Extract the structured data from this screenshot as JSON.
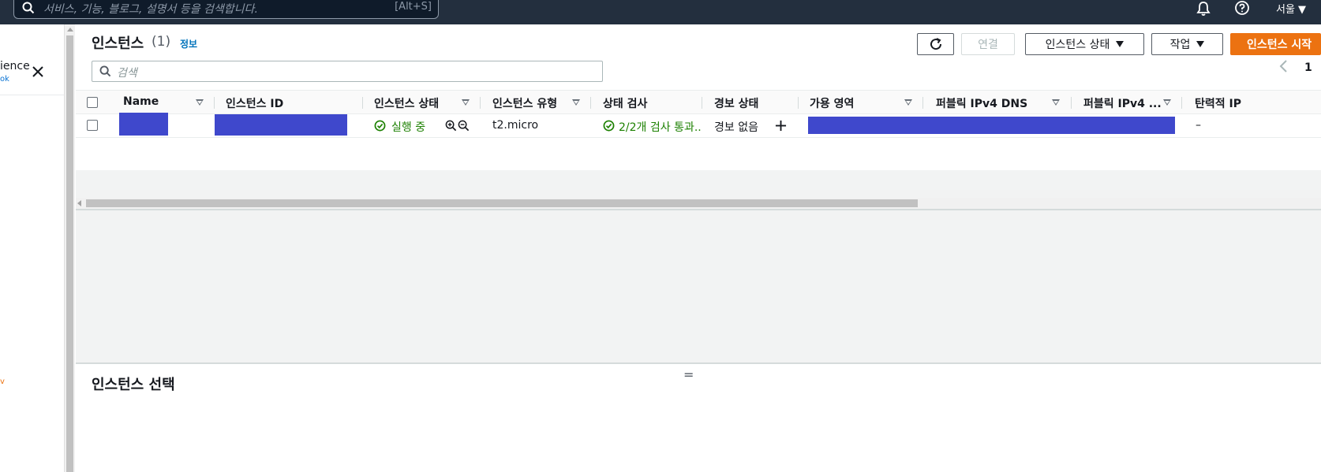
{
  "top_nav": {
    "search_placeholder": "서비스, 기능, 블로그, 설명서 등을 검색합니다.",
    "search_shortcut": "[Alt+S]",
    "region": "서울 ▼",
    "icons": [
      "search-icon",
      "bell-icon",
      "help-icon"
    ]
  },
  "side_panel": {
    "text_1": "ience",
    "text_2": "ok",
    "text_3": "v",
    "close_icon": "close-icon"
  },
  "header": {
    "title": "인스턴스",
    "count": "(1)",
    "info_link": "정보",
    "buttons": {
      "connect": "연결",
      "instance_state": "인스턴스 상태",
      "actions": "작업",
      "launch": "인스턴스 시작"
    }
  },
  "filter": {
    "placeholder": "검색"
  },
  "pagination": {
    "current_page": "1"
  },
  "table": {
    "columns": [
      "Name",
      "인스턴스 ID",
      "인스턴스 상태",
      "인스턴스 유형",
      "상태 검사",
      "경보 상태",
      "가용 영역",
      "퍼블릭 IPv4 DNS",
      "퍼블릭 IPv4 ...",
      "탄력적 IP"
    ],
    "rows": [
      {
        "name": "",
        "instance_id": "",
        "state": "실행 중",
        "type": "t2.micro",
        "status_check": "2/2개 검사 통과...",
        "alarm": "경보 없음",
        "elastic_ip": "–"
      }
    ]
  },
  "details": {
    "title": "인스턴스 선택",
    "drag_handle": "="
  }
}
